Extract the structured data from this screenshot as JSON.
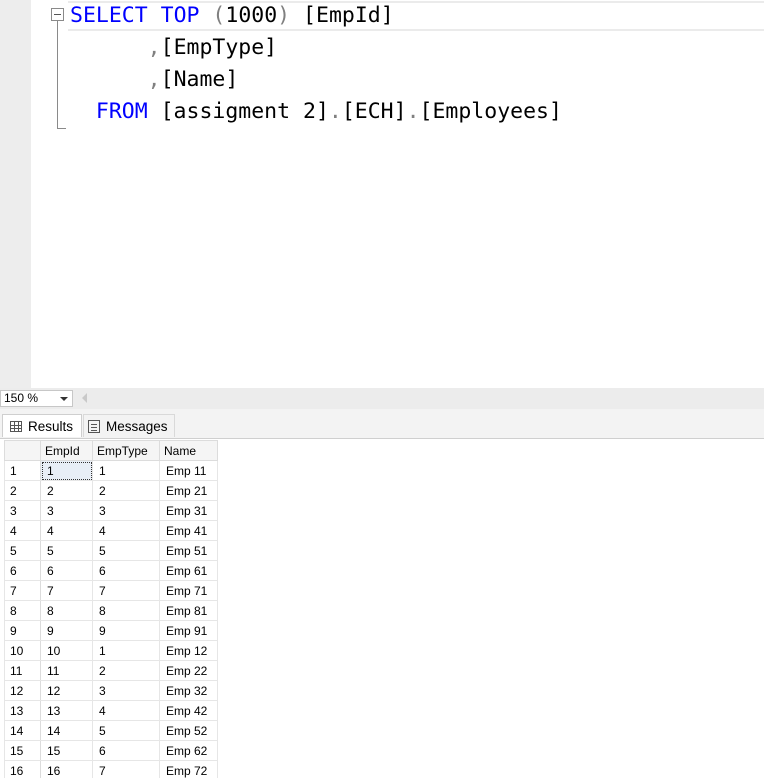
{
  "editor": {
    "lines": [
      {
        "parts": [
          {
            "t": "SELECT",
            "c": "kw"
          },
          {
            "t": " ",
            "c": ""
          },
          {
            "t": "TOP",
            "c": "kw"
          },
          {
            "t": " ",
            "c": ""
          },
          {
            "t": "(",
            "c": "punc"
          },
          {
            "t": "1000",
            "c": ""
          },
          {
            "t": ")",
            "c": "punc"
          },
          {
            "t": " [EmpId]",
            "c": ""
          }
        ]
      },
      {
        "parts": [
          {
            "t": "      ",
            "c": ""
          },
          {
            "t": ",",
            "c": "punc"
          },
          {
            "t": "[EmpType]",
            "c": ""
          }
        ]
      },
      {
        "parts": [
          {
            "t": "      ",
            "c": ""
          },
          {
            "t": ",",
            "c": "punc"
          },
          {
            "t": "[Name]",
            "c": ""
          }
        ]
      },
      {
        "parts": [
          {
            "t": "  ",
            "c": ""
          },
          {
            "t": "FROM",
            "c": "kw"
          },
          {
            "t": " [assigment 2]",
            "c": ""
          },
          {
            "t": ".",
            "c": "punc"
          },
          {
            "t": "[ECH]",
            "c": ""
          },
          {
            "t": ".",
            "c": "punc"
          },
          {
            "t": "[Employees]",
            "c": ""
          }
        ]
      }
    ]
  },
  "zoom": {
    "value": "150 %"
  },
  "tabs": {
    "results": "Results",
    "messages": "Messages"
  },
  "grid": {
    "columns": [
      "EmpId",
      "EmpType",
      "Name"
    ],
    "rows": [
      [
        "1",
        "1",
        "Emp 11"
      ],
      [
        "2",
        "2",
        "Emp 21"
      ],
      [
        "3",
        "3",
        "Emp 31"
      ],
      [
        "4",
        "4",
        "Emp 41"
      ],
      [
        "5",
        "5",
        "Emp 51"
      ],
      [
        "6",
        "6",
        "Emp 61"
      ],
      [
        "7",
        "7",
        "Emp 71"
      ],
      [
        "8",
        "8",
        "Emp 81"
      ],
      [
        "9",
        "9",
        "Emp 91"
      ],
      [
        "10",
        "1",
        "Emp 12"
      ],
      [
        "11",
        "2",
        "Emp 22"
      ],
      [
        "12",
        "3",
        "Emp 32"
      ],
      [
        "13",
        "4",
        "Emp 42"
      ],
      [
        "14",
        "5",
        "Emp 52"
      ],
      [
        "15",
        "6",
        "Emp 62"
      ],
      [
        "16",
        "7",
        "Emp 72"
      ]
    ]
  },
  "colors": {
    "keyword": "#0000ff",
    "punctuation": "#808080"
  }
}
